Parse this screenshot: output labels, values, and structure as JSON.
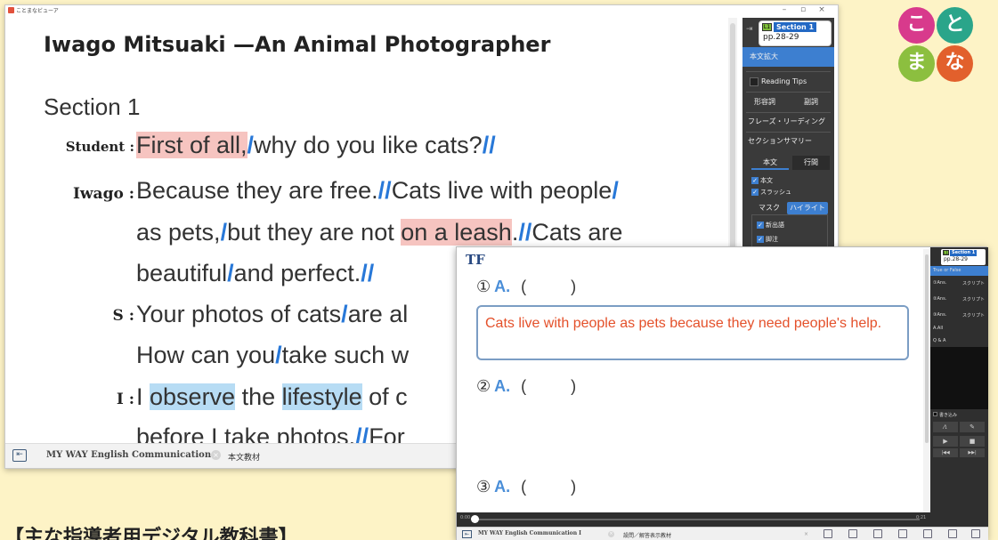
{
  "app": {
    "title": "ことまなビューア",
    "window_controls": [
      "–",
      "▫",
      "×"
    ]
  },
  "doc": {
    "title": "Iwago Mitsuaki —An Animal Photographer",
    "section": "Section 1",
    "lines": {
      "l1_speaker": "Student :",
      "l1_a": "First of all,",
      "l1_b": "/",
      "l1_c": "why do you like cats?",
      "l1_d": "//",
      "l2_speaker": "Iwago :",
      "l2_a": "Because they are free.",
      "l2_b": "//",
      "l2_c": "Cats live with people",
      "l2_d": "/",
      "l3_a": "as pets,",
      "l3_b": "/",
      "l3_c": "but they are not ",
      "l3_d": "on a leash",
      "l3_e": ".",
      "l3_f": "//",
      "l3_g": "Cats are",
      "l4_a": "beautiful",
      "l4_b": "/",
      "l4_c": "and perfect.",
      "l4_d": "//",
      "l5_speaker": "S :",
      "l5_a": "Your photos of cats",
      "l5_b": "/",
      "l5_c": "are al",
      "l6_a": "How can you",
      "l6_b": "/",
      "l6_c": "take such w",
      "l7_speaker": "I :",
      "l7_a": "I ",
      "l7_b": "observe",
      "l7_c": " the ",
      "l7_d": "lifestyle",
      "l7_e": " of c",
      "l8_a": "before I take photos.",
      "l8_b": "//",
      "l8_c": "For"
    }
  },
  "statusbar": {
    "tab_label": "MY WAY English Communication I",
    "close": "×",
    "tab2_label": "本文教材"
  },
  "panel": {
    "pin": "⇥",
    "section_level": "L1",
    "section_name": "Section 1",
    "pages": "pp.28-29",
    "zoom_label": "本文拡大",
    "reading_tips": "Reading Tips",
    "adjective": "形容詞",
    "adverb": "副詞",
    "phrase_reading": "フレーズ・リーディング",
    "section_summary": "セクションサマリー",
    "tab_body": "本文",
    "tab_spacing": "行間",
    "cb_body": "本文",
    "cb_slash": "スラッシュ",
    "mask": "マスク",
    "highlight": "ハイライト",
    "new_words": "新出語",
    "footnote": "脚注"
  },
  "quiz": {
    "label": "TF",
    "q1_num": "①",
    "q1_a": "A.",
    "q1_paren": "(          )",
    "answer": "Cats live with people as pets because they need people's help.",
    "q2_num": "②",
    "q2_a": "A.",
    "q2_paren": "(          )",
    "q3_num": "③",
    "q3_a": "A.",
    "q3_paren": "(          )",
    "time_start": "0:00",
    "time_end": "0:21"
  },
  "statusbar2": {
    "tab_label": "MY WAY English Communication I",
    "close": "×",
    "tab2_label": "設問／解答表示教材",
    "close2": "×"
  },
  "panel2": {
    "section_level": "L1",
    "section_name": "Section 1",
    "pages": "pp.28-29",
    "true_false": "True or False",
    "r1a": "①Ans.",
    "r1b": "スクリプト",
    "r2a": "②Ans.",
    "r2b": "スクリプト",
    "r3a": "③Ans.",
    "r3b": "スクリプト",
    "all_ans": "A.All",
    "qa": "Q & A",
    "write": "書き込み",
    "pen1": "⁄₁",
    "pen2": "✎",
    "play": "▶",
    "stop": "■",
    "prev": "|◀◀",
    "next": "▶▶|"
  },
  "logo": {
    "chars": [
      "こ",
      "と",
      "ま",
      "な"
    ],
    "colors": [
      "#d83a8c",
      "#2aa58a",
      "#8cbf3f",
      "#e2602c"
    ]
  },
  "caption": "【主な指導者用デジタル教科書】"
}
